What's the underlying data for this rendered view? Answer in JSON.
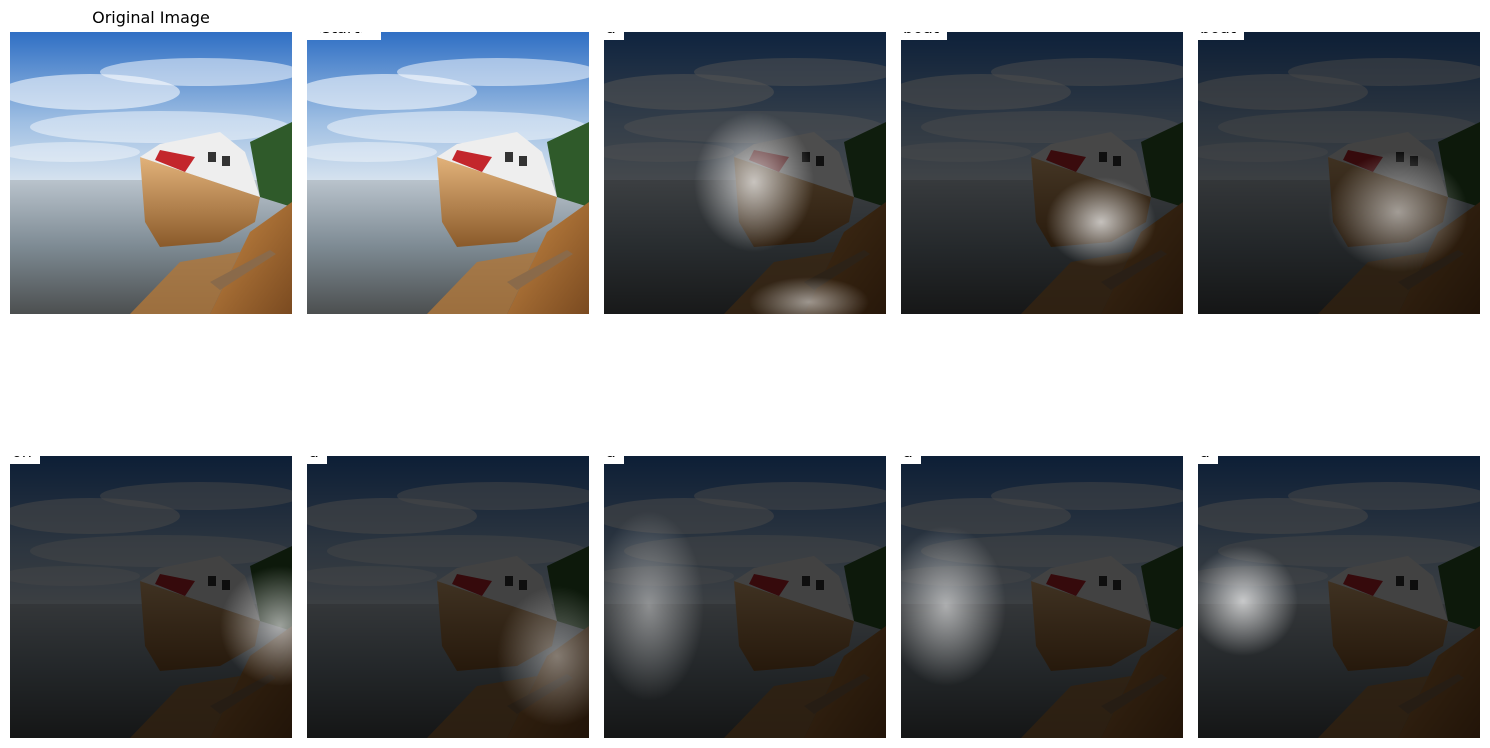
{
  "figure": {
    "original_title": "Original Image",
    "tokens": [
      "<start>",
      "a",
      "boat",
      "boat",
      "on",
      "a",
      "a",
      "a",
      "a"
    ]
  }
}
